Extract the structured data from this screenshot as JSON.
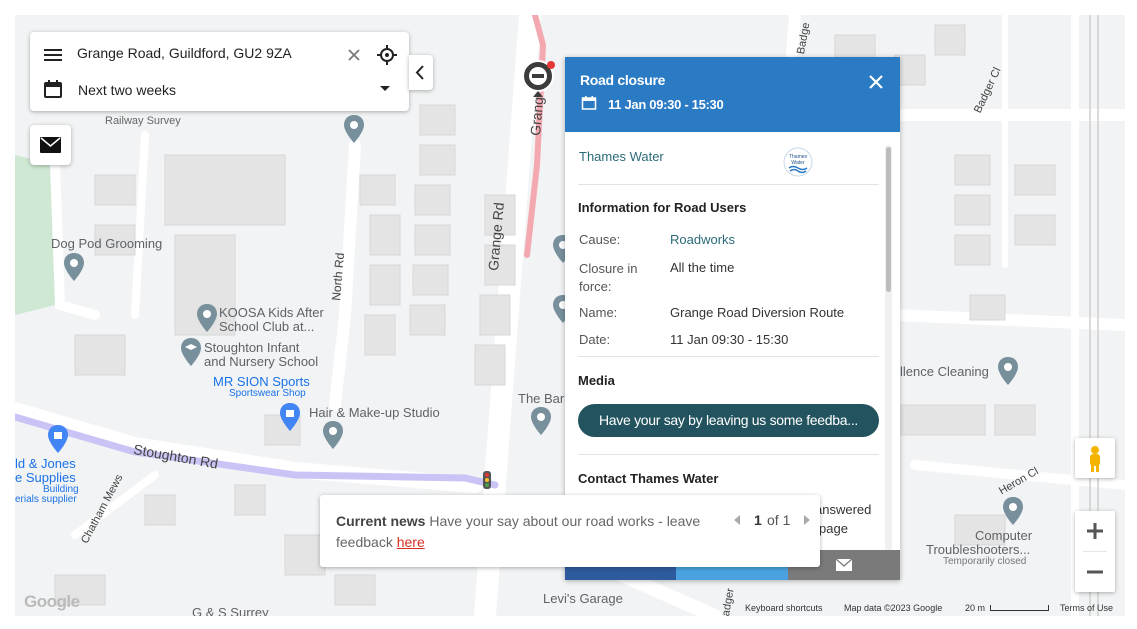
{
  "search": {
    "location": "Grange Road, Guildford, GU2 9ZA",
    "date_range": "Next two weeks"
  },
  "map": {
    "labels": {
      "dog_pod": "Dog Pod Grooming",
      "koosa_1": "KOOSA Kids After",
      "koosa_2": "School Club at...",
      "stoughton_1": "Stoughton Infant",
      "stoughton_2": "and Nursery School",
      "mr_sion": "MR SION Sports",
      "sportswear": "Sportswear Shop",
      "hair": "Hair & Make-up Studio",
      "the_bar": "The Bar",
      "jones_1": "ld & Jones",
      "jones_2": "e Supplies",
      "jones_3": "Building",
      "jones_4": "erials supplier",
      "cleaning": "llence Cleaning",
      "computer_1": "Computer",
      "computer_2": "Troubleshooters...",
      "computer_3": "Temporarily closed",
      "levis": "Levi's Garage",
      "gs": "G & S Surrey",
      "grange_rd": "Grange Rd",
      "grange_top": "Grang",
      "north_rd": "North Rd",
      "stoughton_rd": "Stoughton Rd",
      "chatham": "Chatham Mews",
      "badger_cl": "Badger Cl",
      "badger_top": "Badge",
      "badger_bottom": "adger",
      "heron_cl": "Heron Cl",
      "railway": "Railway Survey"
    },
    "footer": {
      "keyboard": "Keyboard shortcuts",
      "mapdata": "Map data ©2023 Google",
      "scale": "20 m",
      "terms": "Terms of Use"
    },
    "google": "Google"
  },
  "panel": {
    "title": "Road closure",
    "date": "11 Jan 09:30 - 15:30",
    "org": "Thames Water",
    "logo_text_1": "Thames",
    "logo_text_2": "Water",
    "section_info": "Information for Road Users",
    "rows": [
      {
        "k": "Cause:",
        "v": "Roadworks"
      },
      {
        "k": "Closure in force:",
        "v": "All the time"
      },
      {
        "k": "Name:",
        "v": "Grange Road Diversion Route"
      },
      {
        "k": "Date:",
        "v": "11 Jan 09:30 - 15:30"
      }
    ],
    "section_media": "Media",
    "feedback_button": "Have your say by leaving us some feedba...",
    "section_contact": "Contact Thames Water",
    "partial_1": "answered",
    "partial_2": "page"
  },
  "news": {
    "heading": "Current news",
    "text": "Have your say about our road works - leave feedback",
    "link": "here",
    "page_current": "1",
    "page_of": "of 1"
  },
  "colors": {
    "panel_header": "#2a7ac4",
    "feedback_button": "#22535f",
    "route": "#c9c4f5",
    "closure": "#f4a9b1",
    "link": "#d93025"
  }
}
